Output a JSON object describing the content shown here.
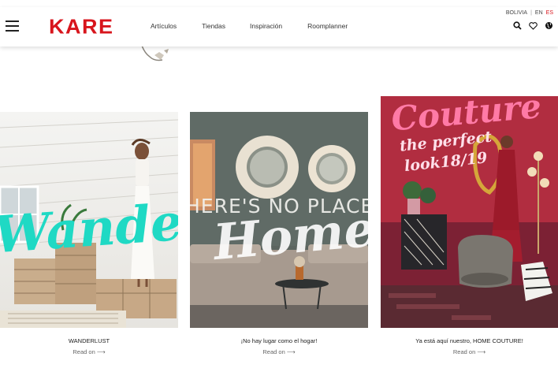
{
  "header": {
    "logo": "KARE",
    "nav": [
      "Artículos",
      "Tiendas",
      "Inspiración",
      "Roomplanner"
    ],
    "country": "BOLIVIA",
    "separator": "|",
    "lang_en": "EN",
    "lang_es": "ES"
  },
  "cards": [
    {
      "image_text": "Wanderlust",
      "title": "WANDERLUST",
      "read_on": "Read on ⟶"
    },
    {
      "image_text_top": "HERE'S NO PLACE LI",
      "image_text": "Home",
      "title": "¡No hay lugar como el hogar!",
      "read_on": "Read on ⟶"
    },
    {
      "image_text": "Couture",
      "image_text_sub1": "the perfect",
      "image_text_sub2": "look18/19",
      "title": "Ya está aquí nuestro, HOME COUTURE!",
      "read_on": "Read on ⟶"
    }
  ],
  "colors": {
    "brand": "#d8151c",
    "teal": "#1fd9c4",
    "pink": "#ff6fa0"
  },
  "icons": [
    "menu-icon",
    "search-icon",
    "heart-icon",
    "globe-icon"
  ]
}
